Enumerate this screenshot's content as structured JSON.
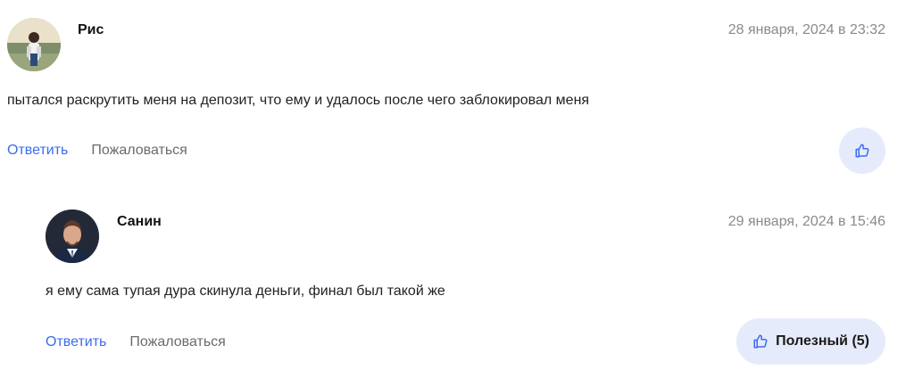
{
  "comments": [
    {
      "author": "Рис",
      "date": "28 января, 2024 в 23:32",
      "text": "пытался раскрутить меня на депозит, что ему и удалось после чего заблокировал меня",
      "reply_label": "Ответить",
      "report_label": "Пожаловаться"
    },
    {
      "author": "Санин",
      "date": "29 января, 2024 в 15:46",
      "text": "я ему сама тупая дура скинула деньги, финал был такой же",
      "reply_label": "Ответить",
      "report_label": "Пожаловаться",
      "helpful_label": "Полезный (5)"
    }
  ],
  "colors": {
    "link": "#3b6cf0",
    "like_bg": "#e6ebfc",
    "date": "#8a8a8a"
  },
  "icons": {
    "like": "thumbs-up-icon"
  }
}
